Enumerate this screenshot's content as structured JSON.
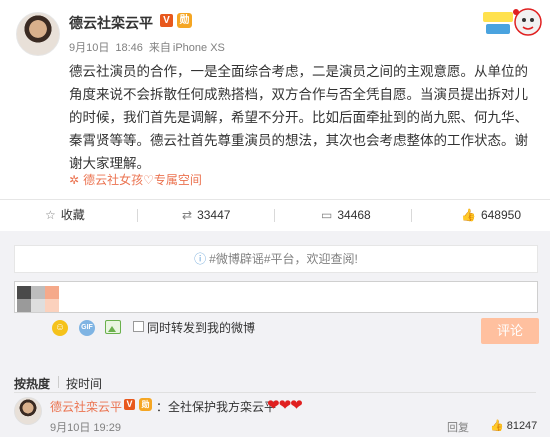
{
  "post": {
    "author": "德云社栾云平",
    "verified_badge": "V",
    "medal_badge": "勋",
    "meta": {
      "date": "9月10日",
      "time": "18:46",
      "source_prefix": "来自",
      "source": "iPhone XS"
    },
    "body": "德云社演员的合作，一是全面综合考虑，二是演员之间的主观意愿。从单位的角度来说不会拆散任何成熟搭档，双方合作与否全凭自愿。当演员提出拆对儿的时候，我们首先是调解，希望不分开。比如后面牵扯到的尚九熙、何九华、秦霄贤等等。德云社首先尊重演员的想法，其次也会考虑整体的工作状态。谢谢大家理解。",
    "super_topic": "德云社女孩♡专属空间",
    "sticker_icon": "cartoon-sticker-icon"
  },
  "actions": {
    "favorite": {
      "label": "收藏",
      "icon": "star-icon"
    },
    "repost": {
      "count": "33447",
      "icon": "repost-icon"
    },
    "comment": {
      "count": "34468",
      "icon": "comment-icon"
    },
    "like": {
      "count": "648950",
      "icon": "thumbs-up-icon"
    }
  },
  "rumor_bar": {
    "text": "#微博辟谣#平台，欢迎查阅!",
    "icon": "info-icon"
  },
  "composer": {
    "input_value": "",
    "repost_checkbox_label": "同时转发到我的微博",
    "submit_label": "评论",
    "tools": [
      "emoji-icon",
      "gif-icon",
      "image-icon"
    ]
  },
  "comment_sort": {
    "hot": "按热度",
    "time": "按时间"
  },
  "comments": [
    {
      "author": "德云社栾云平",
      "verified_badge": "V",
      "medal_badge": "勋",
      "text": "：全社保护我方栾云平",
      "hearts": "❤❤❤",
      "date": "9月10日 19:29",
      "report_label": "回复",
      "likes": "81247"
    }
  ],
  "colors": {
    "accent": "#eb7350",
    "submit_disabled": "#ffc09f",
    "comment_bg": "#f2f2f5",
    "heart": "#e02020"
  }
}
